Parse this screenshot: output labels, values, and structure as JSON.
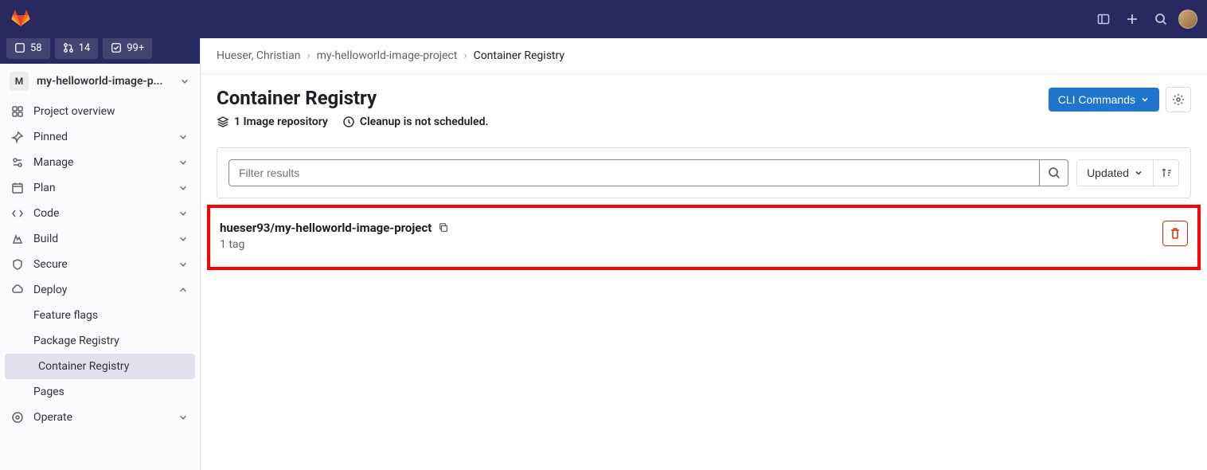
{
  "topbar": {
    "counters": {
      "issues": "58",
      "merge_requests": "14",
      "todos": "99+"
    }
  },
  "sidebar": {
    "project": {
      "avatar_letter": "M",
      "name": "my-helloworld-image-p..."
    },
    "items": [
      {
        "label": "Project overview",
        "icon": "overview",
        "expandable": false
      },
      {
        "label": "Pinned",
        "icon": "pin",
        "expandable": true
      },
      {
        "label": "Manage",
        "icon": "manage",
        "expandable": true
      },
      {
        "label": "Plan",
        "icon": "plan",
        "expandable": true
      },
      {
        "label": "Code",
        "icon": "code",
        "expandable": true
      },
      {
        "label": "Build",
        "icon": "build",
        "expandable": true
      },
      {
        "label": "Secure",
        "icon": "secure",
        "expandable": true
      },
      {
        "label": "Deploy",
        "icon": "deploy",
        "expandable": true,
        "expanded": true,
        "children": [
          {
            "label": "Feature flags"
          },
          {
            "label": "Package Registry"
          },
          {
            "label": "Container Registry",
            "active": true
          },
          {
            "label": "Pages"
          }
        ]
      },
      {
        "label": "Operate",
        "icon": "operate",
        "expandable": true
      }
    ]
  },
  "breadcrumb": {
    "items": [
      {
        "label": "Hueser, Christian"
      },
      {
        "label": "my-helloworld-image-project"
      },
      {
        "label": "Container Registry",
        "current": true
      }
    ]
  },
  "page": {
    "title": "Container Registry",
    "repo_count": "1 Image repository",
    "cleanup_status": "Cleanup is not scheduled.",
    "cli_button": "CLI Commands"
  },
  "filter": {
    "placeholder": "Filter results",
    "sort_label": "Updated"
  },
  "repo": {
    "name": "hueser93/my-helloworld-image-project",
    "tag_count": "1 tag"
  }
}
